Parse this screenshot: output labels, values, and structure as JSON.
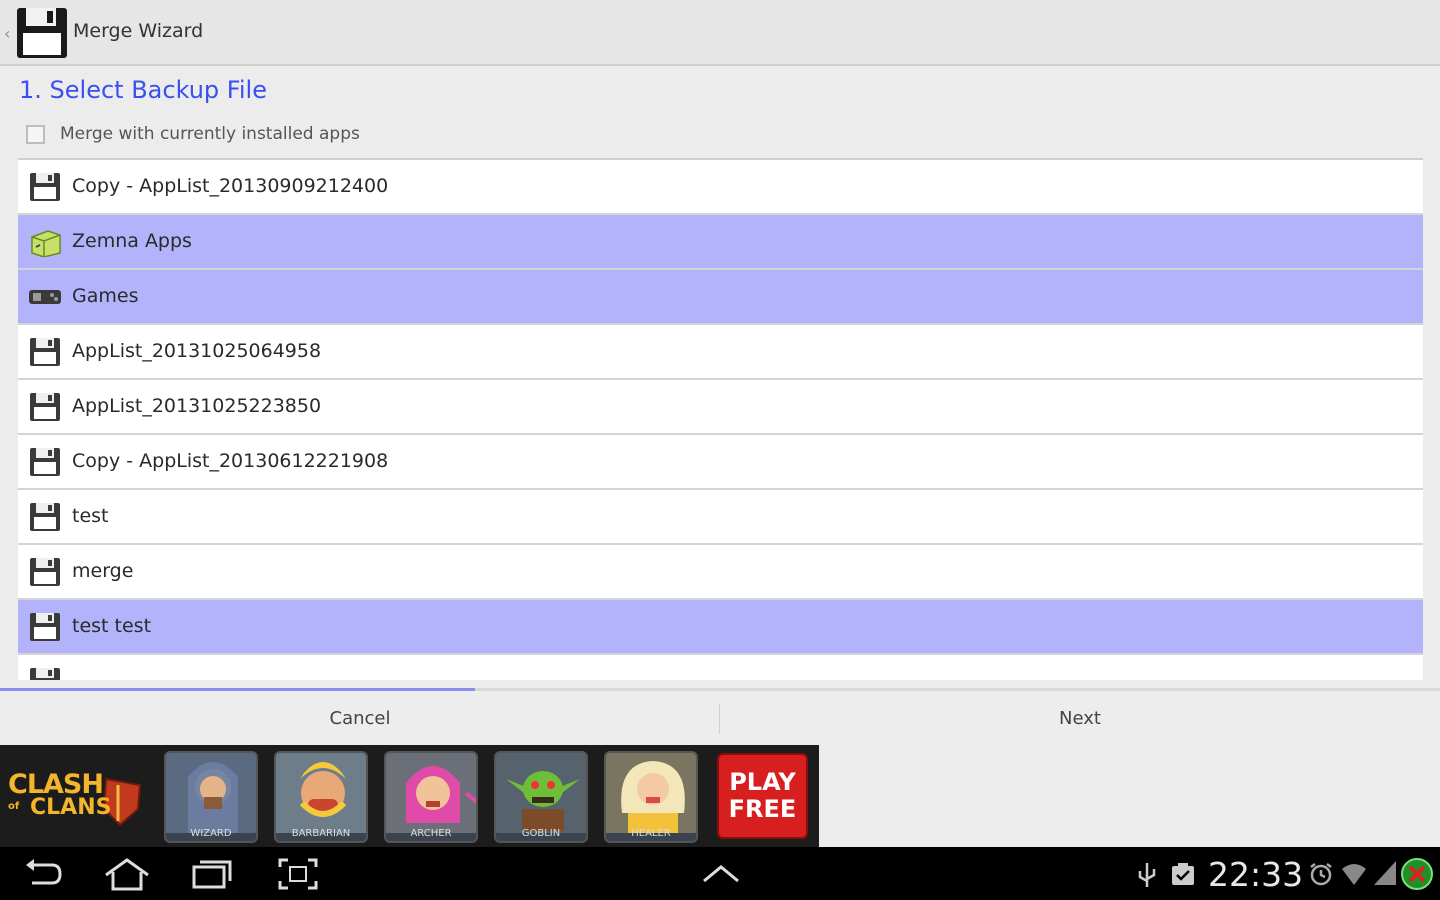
{
  "app": {
    "title": "Merge Wizard",
    "up_icon": "chevron-left-icon",
    "icon": "floppy-disk-icon"
  },
  "step": {
    "title": "1. Select Backup File"
  },
  "merge_option": {
    "label": "Merge with currently installed apps",
    "checked": false
  },
  "backup_list": {
    "items": [
      {
        "label": "Copy - AppList_20130909212400",
        "icon": "floppy-disk-icon",
        "selected": false
      },
      {
        "label": "Zemna Apps",
        "icon": "app-package-icon",
        "selected": true
      },
      {
        "label": "Games",
        "icon": "gamepad-icon",
        "selected": true
      },
      {
        "label": "AppList_20131025064958",
        "icon": "floppy-disk-icon",
        "selected": false
      },
      {
        "label": "AppList_20131025223850",
        "icon": "floppy-disk-icon",
        "selected": false
      },
      {
        "label": "Copy - AppList_20130612221908",
        "icon": "floppy-disk-icon",
        "selected": false
      },
      {
        "label": "test",
        "icon": "floppy-disk-icon",
        "selected": false
      },
      {
        "label": "merge",
        "icon": "floppy-disk-icon",
        "selected": false
      },
      {
        "label": "test test",
        "icon": "floppy-disk-icon",
        "selected": true
      },
      {
        "label": "",
        "icon": "floppy-disk-icon",
        "selected": false
      }
    ]
  },
  "wizard_progress": 0.33,
  "buttons": {
    "cancel": "Cancel",
    "next": "Next"
  },
  "ad": {
    "logo_line1": "CLASH",
    "logo_line2": "CLANS",
    "logo_of": "of",
    "heroes": [
      "WIZARD",
      "BARBARIAN",
      "ARCHER",
      "GOBLIN",
      "HEALER"
    ],
    "cta_line1": "PLAY",
    "cta_line2": "FREE"
  },
  "system_bar": {
    "time": "22:33",
    "left_icons": [
      "back-icon",
      "home-icon",
      "recent-apps-icon",
      "screenshot-icon"
    ],
    "center_icon": "chevron-up-icon",
    "right_icons": [
      "usb-icon",
      "clipboard-check-icon",
      "alarm-icon",
      "wifi-icon",
      "signal-icon",
      "close-circle-icon"
    ]
  },
  "colors": {
    "accent": "#3a4ff0",
    "selected_row": "#b3b3fb",
    "ad_button": "#d81f1f"
  }
}
